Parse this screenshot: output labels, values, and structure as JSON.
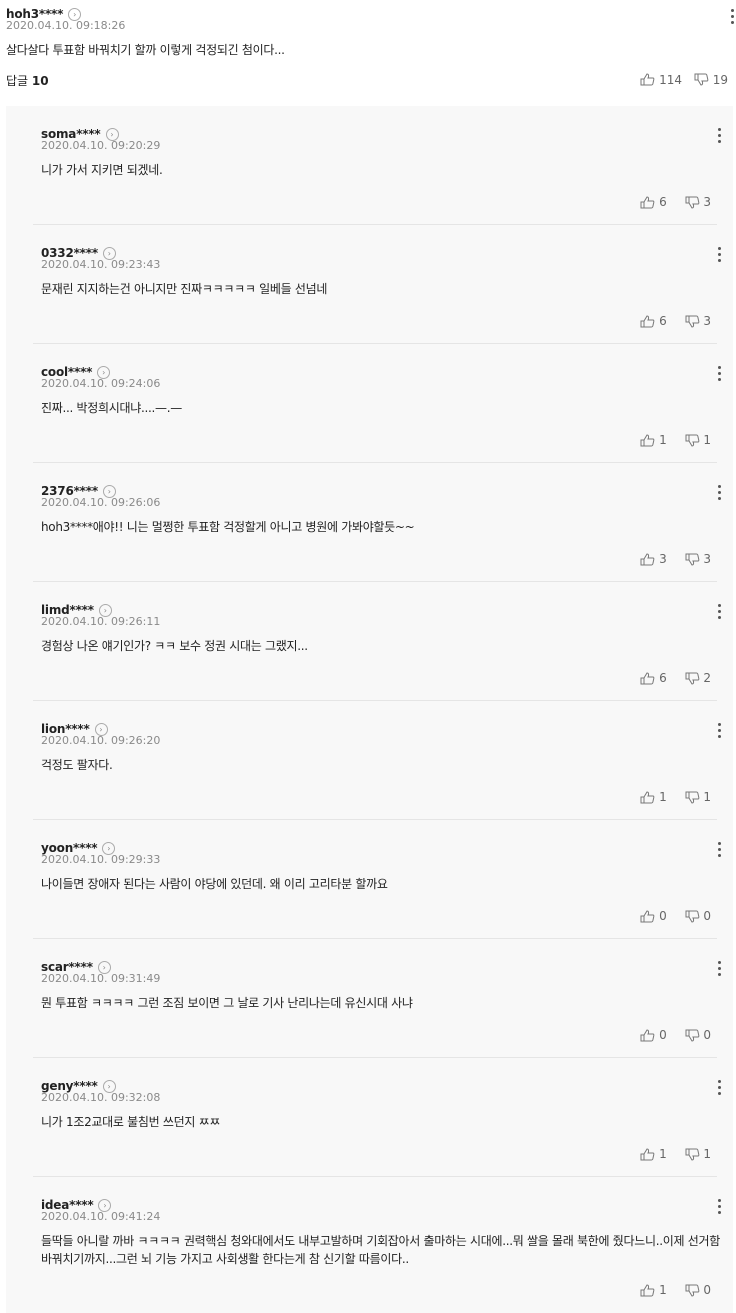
{
  "parent": {
    "username": "hoh3****",
    "timestamp": "2020.04.10. 09:18:26",
    "text": "살다살다 투표함 바꿔치기 할까 이렇게 걱정되긴 첨이다...",
    "reply_label": "답글",
    "reply_count": "10",
    "likes": "114",
    "dislikes": "19"
  },
  "replies": [
    {
      "username": "soma****",
      "timestamp": "2020.04.10. 09:20:29",
      "text": "니가 가서 지키면 되겠네.",
      "likes": "6",
      "dislikes": "3"
    },
    {
      "username": "0332****",
      "timestamp": "2020.04.10. 09:23:43",
      "text": "문재린 지지하는건 아니지만 진짜ㅋㅋㅋㅋㅋ 일베들 선넘네",
      "likes": "6",
      "dislikes": "3"
    },
    {
      "username": "cool****",
      "timestamp": "2020.04.10. 09:24:06",
      "text": "진짜... 박정희시대냐....—.—",
      "likes": "1",
      "dislikes": "1"
    },
    {
      "username": "2376****",
      "timestamp": "2020.04.10. 09:26:06",
      "text": "hoh3****애야!! 니는 멀쩡한 투표함 걱정할게 아니고 병원에 가봐야할듯~~",
      "likes": "3",
      "dislikes": "3"
    },
    {
      "username": "limd****",
      "timestamp": "2020.04.10. 09:26:11",
      "text": "경험상 나온 얘기인가? ㅋㅋ 보수 정권 시대는 그랬지...",
      "likes": "6",
      "dislikes": "2"
    },
    {
      "username": "lion****",
      "timestamp": "2020.04.10. 09:26:20",
      "text": "걱정도 팔자다.",
      "likes": "1",
      "dislikes": "1"
    },
    {
      "username": "yoon****",
      "timestamp": "2020.04.10. 09:29:33",
      "text": "나이들면 장애자 된다는 사람이 야당에 있던데. 왜 이리 고리타분 할까요",
      "likes": "0",
      "dislikes": "0"
    },
    {
      "username": "scar****",
      "timestamp": "2020.04.10. 09:31:49",
      "text": "뭔 투표함 ㅋㅋㅋㅋ 그런 조짐 보이면 그 날로 기사 난리나는데 유신시대 사냐",
      "likes": "0",
      "dislikes": "0"
    },
    {
      "username": "geny****",
      "timestamp": "2020.04.10. 09:32:08",
      "text": "니가 1조2교대로 불침번 쓰던지 ㅉㅉ",
      "likes": "1",
      "dislikes": "1"
    },
    {
      "username": "idea****",
      "timestamp": "2020.04.10. 09:41:24",
      "text": "들딱들 아니랄 까바 ㅋㅋㅋㅋ 권력핵심 청와대에서도 내부고발하며 기회잡아서 출마하는 시대에...뭐 쌀을 몰래 북한에 줬다느니..이제 선거함 바꿔치기까지...그런 뇌 기능 가지고 사회생활 한다는게 참 신기할 따름이다..",
      "likes": "1",
      "dislikes": "0"
    }
  ],
  "icons": {
    "profile_chevron": "chevron-right-icon",
    "more": "more-vertical-icon",
    "like": "thumbs-up-icon",
    "dislike": "thumbs-down-icon"
  }
}
